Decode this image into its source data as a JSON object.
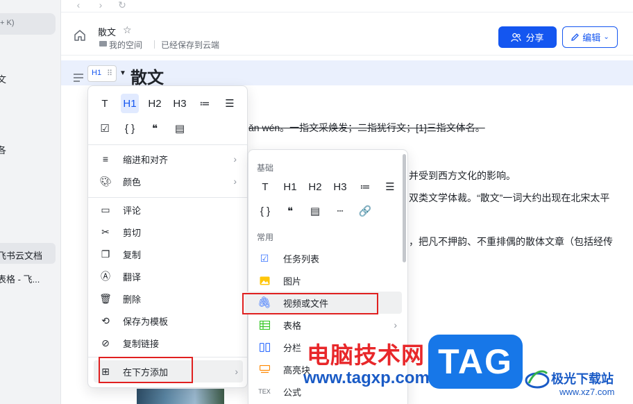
{
  "sidebar": {
    "search_hint": "+ K)",
    "items": [
      {
        "label": "文"
      },
      {
        "label": "各"
      },
      {
        "label": "飞书云文档"
      },
      {
        "label": "表格 - 飞..."
      }
    ]
  },
  "header": {
    "title": "散文",
    "breadcrumb_space": "我的空间",
    "save_status": "已经保存到云端",
    "share_label": "分享",
    "edit_label": "编辑",
    "accent_color": "#1456f0"
  },
  "editor": {
    "block_type": "H1",
    "heading": "散文",
    "lines": [
      {
        "text": "ǎn wén。一指文采焕发；二指犹行文；[1]三指文体名。"
      },
      {
        "text": "并受到西方文化的影响。"
      },
      {
        "text": "双类文学体裁。“散文”一词大约出现在北宋太平"
      },
      {
        "text": "，把凡不押韵、不重排偶的散体文章（包括经传"
      }
    ]
  },
  "context_menu": {
    "format_icons": [
      {
        "glyph": "T",
        "name": "text"
      },
      {
        "glyph": "H1",
        "name": "heading1",
        "active": true
      },
      {
        "glyph": "H2",
        "name": "heading2"
      },
      {
        "glyph": "H3",
        "name": "heading3"
      },
      {
        "glyph": "≔",
        "name": "ordered-list"
      },
      {
        "glyph": "☰",
        "name": "bullet-list"
      }
    ],
    "format_icons_row2": [
      {
        "glyph": "☑",
        "name": "todo"
      },
      {
        "glyph": "{ }",
        "name": "code-block"
      },
      {
        "glyph": "❝",
        "name": "quote"
      },
      {
        "glyph": "▤",
        "name": "callout"
      }
    ],
    "items": [
      {
        "label": "缩进和对齐",
        "icon": "align-icon",
        "has_sub": true
      },
      {
        "label": "颜色",
        "icon": "palette-icon",
        "has_sub": true
      },
      {
        "label": "评论",
        "icon": "comment-icon"
      },
      {
        "label": "剪切",
        "icon": "scissors-icon"
      },
      {
        "label": "复制",
        "icon": "copy-icon"
      },
      {
        "label": "翻译",
        "icon": "translate-icon"
      },
      {
        "label": "删除",
        "icon": "trash-icon"
      },
      {
        "label": "保存为模板",
        "icon": "template-icon"
      },
      {
        "label": "复制链接",
        "icon": "link-icon"
      },
      {
        "label": "在下方添加",
        "icon": "add-icon",
        "has_sub": true
      }
    ]
  },
  "submenu": {
    "section_basic": "基础",
    "basic_icons_row1": [
      {
        "glyph": "T",
        "name": "text"
      },
      {
        "glyph": "H1",
        "name": "heading1"
      },
      {
        "glyph": "H2",
        "name": "heading2"
      },
      {
        "glyph": "H3",
        "name": "heading3"
      },
      {
        "glyph": "≔",
        "name": "ordered-list"
      },
      {
        "glyph": "☰",
        "name": "bullet-list"
      }
    ],
    "basic_icons_row2": [
      {
        "glyph": "{ }",
        "name": "code-block"
      },
      {
        "glyph": "❝",
        "name": "quote"
      },
      {
        "glyph": "▤",
        "name": "callout"
      },
      {
        "glyph": "┄",
        "name": "divider"
      },
      {
        "glyph": "🔗",
        "name": "link"
      }
    ],
    "section_common": "常用",
    "items": [
      {
        "label": "任务列表",
        "icon": "task-icon",
        "color": "#3370ff"
      },
      {
        "label": "图片",
        "icon": "image-icon",
        "color": "#ffc60a"
      },
      {
        "label": "视频或文件",
        "icon": "attachment-icon",
        "color": "#3370ff"
      },
      {
        "label": "表格",
        "icon": "table-icon",
        "color": "#34c724",
        "has_sub": true
      },
      {
        "label": "分栏",
        "icon": "columns-icon",
        "color": "#3370ff"
      },
      {
        "label": "高亮块",
        "icon": "highlight-icon",
        "color": "#ff8800"
      },
      {
        "label": "公式",
        "icon": "formula-icon",
        "color": "#646a73"
      }
    ]
  },
  "watermark": {
    "site_name": "电脑技术网",
    "site_url": "www.tagxp.com",
    "tag_text": "TAG",
    "brand_name": "极光下载站",
    "brand_url": "www.xz7.com"
  }
}
